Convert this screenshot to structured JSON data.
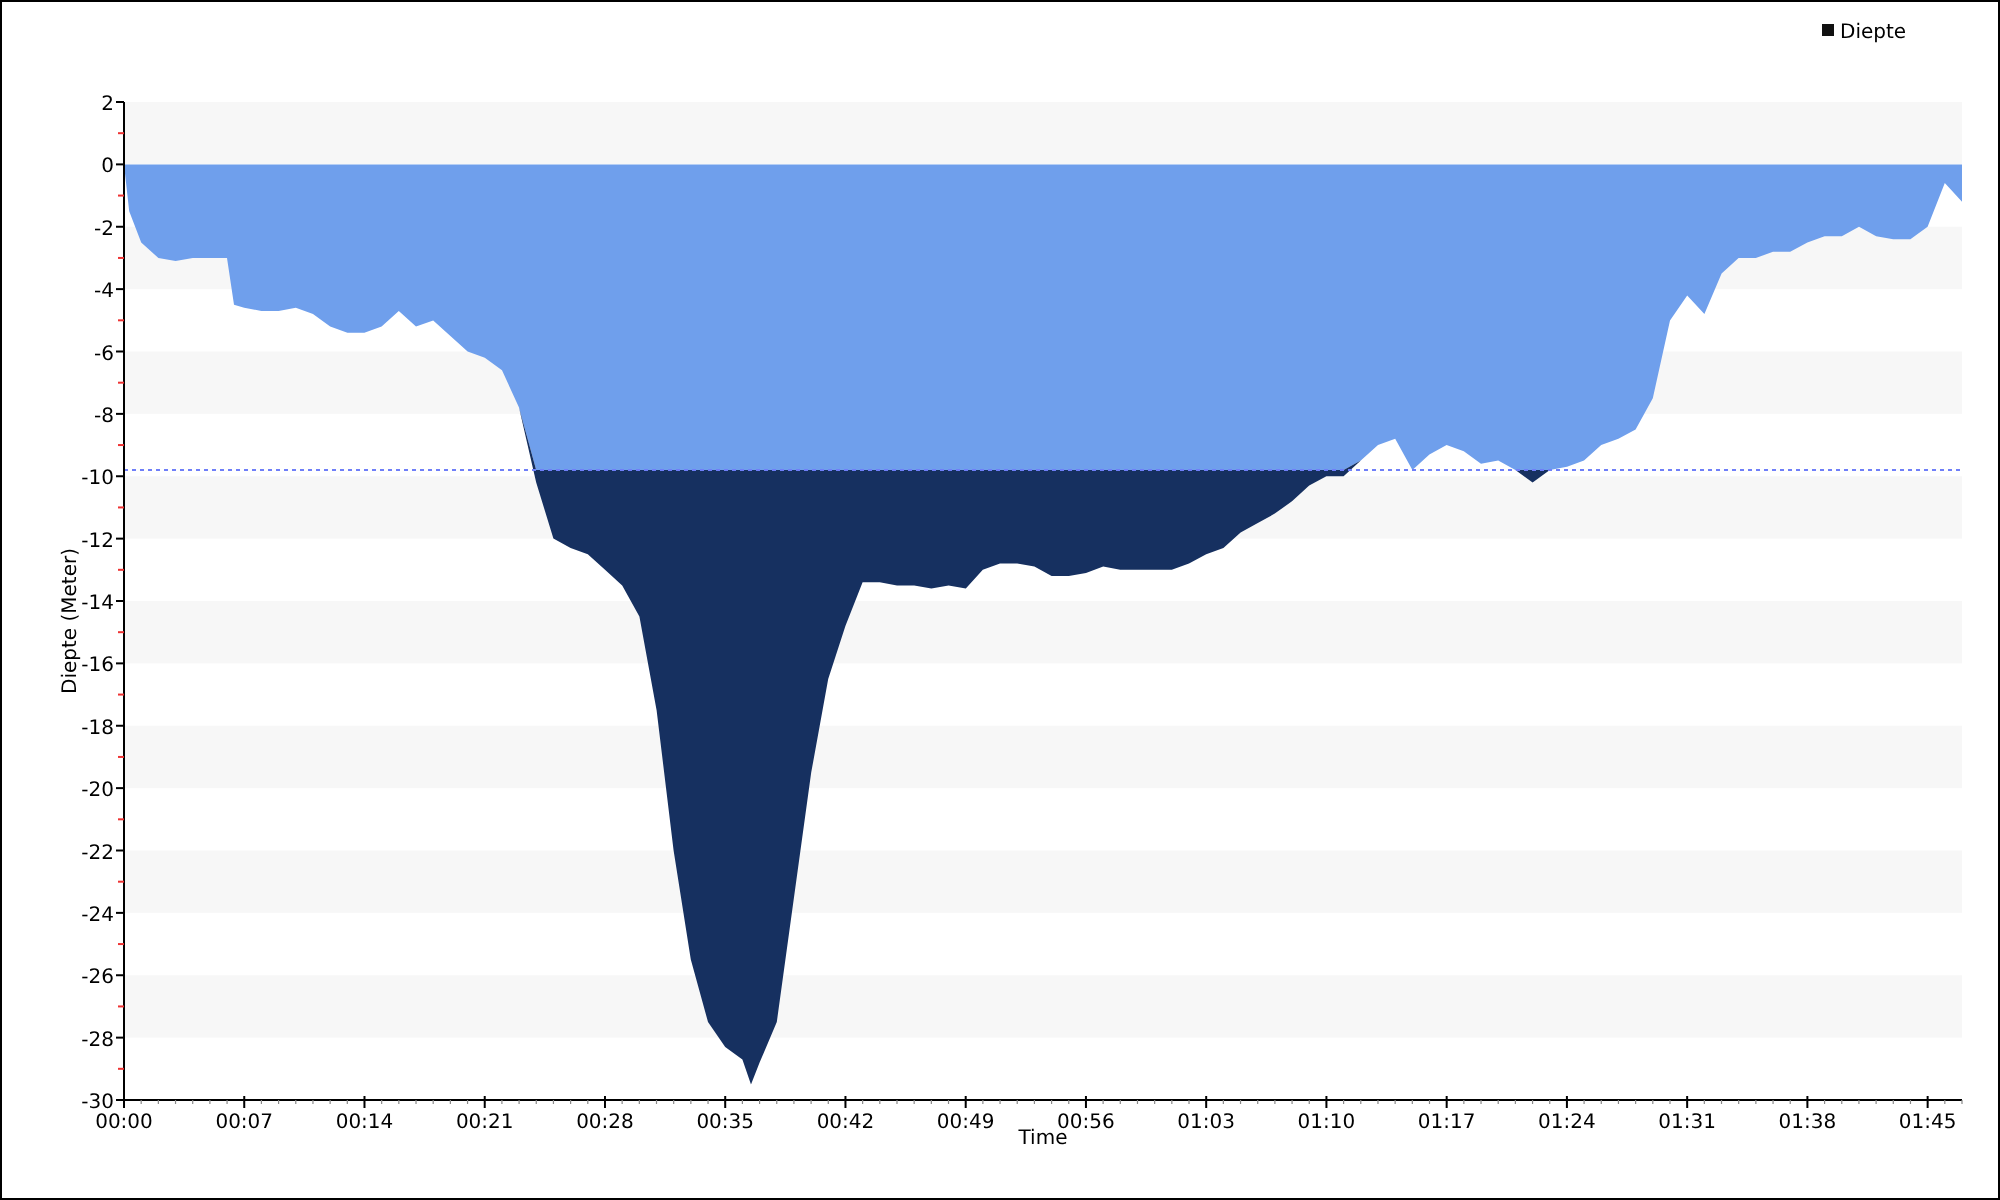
{
  "chart_data": {
    "type": "area",
    "xlabel": "Time",
    "ylabel": "Diepte (Meter)",
    "stacked": true,
    "x": [
      0,
      0.3,
      1,
      2,
      3,
      4,
      5,
      6,
      6.4,
      7,
      8,
      9,
      10,
      11,
      12,
      13,
      14,
      15,
      16,
      17,
      18,
      19,
      20,
      21,
      22,
      23,
      24,
      25,
      26,
      27,
      28,
      29,
      30,
      31,
      32,
      33,
      34,
      35,
      36,
      36.5,
      37,
      38,
      39,
      40,
      41,
      42,
      43,
      44,
      45,
      46,
      47,
      48,
      49,
      50,
      51,
      52,
      53,
      54,
      55,
      56,
      57,
      58,
      59,
      60,
      61,
      62,
      63,
      64,
      65,
      66,
      67,
      68,
      69,
      70,
      71,
      72,
      73,
      74,
      75,
      76,
      77,
      78,
      79,
      80,
      81,
      82,
      83,
      84,
      85,
      86,
      87,
      88,
      89,
      90,
      91,
      92,
      93,
      94,
      95,
      96,
      97,
      98,
      99,
      100,
      101,
      102,
      103,
      104,
      105,
      106,
      107
    ],
    "series": [
      {
        "name": "Diepte",
        "color": "#6f9fec",
        "values": [
          0,
          -1.5,
          -2.5,
          -3.0,
          -3.1,
          -3.0,
          -3.0,
          -3.0,
          -4.5,
          -4.6,
          -4.7,
          -4.7,
          -4.6,
          -4.8,
          -5.2,
          -5.4,
          -5.4,
          -5.2,
          -4.7,
          -5.2,
          -5.0,
          -5.5,
          -6.0,
          -6.2,
          -6.6,
          -7.8,
          -9.8,
          -9.8,
          -9.8,
          -9.8,
          -9.8,
          -9.8,
          -9.8,
          -9.8,
          -9.8,
          -9.8,
          -9.8,
          -9.8,
          -9.8,
          -9.8,
          -9.8,
          -9.8,
          -9.8,
          -9.8,
          -9.8,
          -9.8,
          -9.8,
          -9.8,
          -9.8,
          -9.8,
          -9.8,
          -9.8,
          -9.8,
          -9.8,
          -9.8,
          -9.8,
          -9.8,
          -9.8,
          -9.8,
          -9.8,
          -9.8,
          -9.8,
          -9.8,
          -9.8,
          -9.8,
          -9.8,
          -9.8,
          -9.8,
          -9.8,
          -9.8,
          -9.8,
          -9.8,
          -9.8,
          -9.8,
          -9.8,
          -9.5,
          -9.0,
          -8.8,
          -9.8,
          -9.3,
          -9.0,
          -9.2,
          -9.6,
          -9.5,
          -9.8,
          -9.8,
          -9.8,
          -9.7,
          -9.5,
          -9.0,
          -8.8,
          -8.5,
          -7.5,
          -5.0,
          -4.2,
          -4.8,
          -3.5,
          -3.0,
          -3.0,
          -2.8,
          -2.8,
          -2.5,
          -2.3,
          -2.3,
          -2.0,
          -2.3,
          -2.4,
          -2.4,
          -2.0,
          -0.6,
          -1.2
        ]
      },
      {
        "color": "#163060",
        "values": [
          0,
          0,
          0,
          0,
          0,
          0,
          0,
          0,
          0,
          0,
          0,
          0,
          0,
          0,
          0,
          0,
          0,
          0,
          0,
          0,
          0,
          0,
          0,
          0,
          0,
          0,
          -0.4,
          -2.2,
          -2.5,
          -2.7,
          -3.2,
          -3.7,
          -4.7,
          -7.7,
          -12.2,
          -15.7,
          -17.7,
          -18.5,
          -18.9,
          -19.7,
          -19.0,
          -17.7,
          -13.7,
          -9.7,
          -6.7,
          -5.0,
          -3.6,
          -3.6,
          -3.7,
          -3.7,
          -3.8,
          -3.7,
          -3.8,
          -3.2,
          -3.0,
          -3.0,
          -3.1,
          -3.4,
          -3.4,
          -3.3,
          -3.1,
          -3.2,
          -3.2,
          -3.2,
          -3.2,
          -3.0,
          -2.7,
          -2.5,
          -2.0,
          -1.7,
          -1.4,
          -1.0,
          -0.5,
          -0.2,
          -0.2,
          0,
          0,
          0,
          0,
          0,
          0,
          0,
          0,
          0,
          0,
          -0.4,
          0,
          0,
          0,
          0,
          0,
          0,
          0,
          0,
          0,
          0,
          0,
          0,
          0,
          0,
          0,
          0,
          0,
          0,
          0,
          0,
          0,
          0,
          0,
          0,
          0
        ]
      }
    ],
    "xlim": [
      0,
      107
    ],
    "ylim": [
      -30,
      2
    ],
    "xticks": [
      {
        "value": 0,
        "label": "00:00"
      },
      {
        "value": 7,
        "label": "00:07"
      },
      {
        "value": 14,
        "label": "00:14"
      },
      {
        "value": 21,
        "label": "00:21"
      },
      {
        "value": 28,
        "label": "00:28"
      },
      {
        "value": 35,
        "label": "00:35"
      },
      {
        "value": 42,
        "label": "00:42"
      },
      {
        "value": 49,
        "label": "00:49"
      },
      {
        "value": 56,
        "label": "00:56"
      },
      {
        "value": 63,
        "label": "01:03"
      },
      {
        "value": 70,
        "label": "01:10"
      },
      {
        "value": 77,
        "label": "01:17"
      },
      {
        "value": 84,
        "label": "01:24"
      },
      {
        "value": 91,
        "label": "01:31"
      },
      {
        "value": 98,
        "label": "01:38"
      },
      {
        "value": 105,
        "label": "01:45"
      }
    ],
    "yticks": [
      2,
      0,
      -2,
      -4,
      -6,
      -8,
      -10,
      -12,
      -14,
      -16,
      -18,
      -20,
      -22,
      -24,
      -26,
      -28,
      -30
    ],
    "ref_lines": [
      {
        "axis": "y",
        "value": -9.8
      }
    ]
  }
}
